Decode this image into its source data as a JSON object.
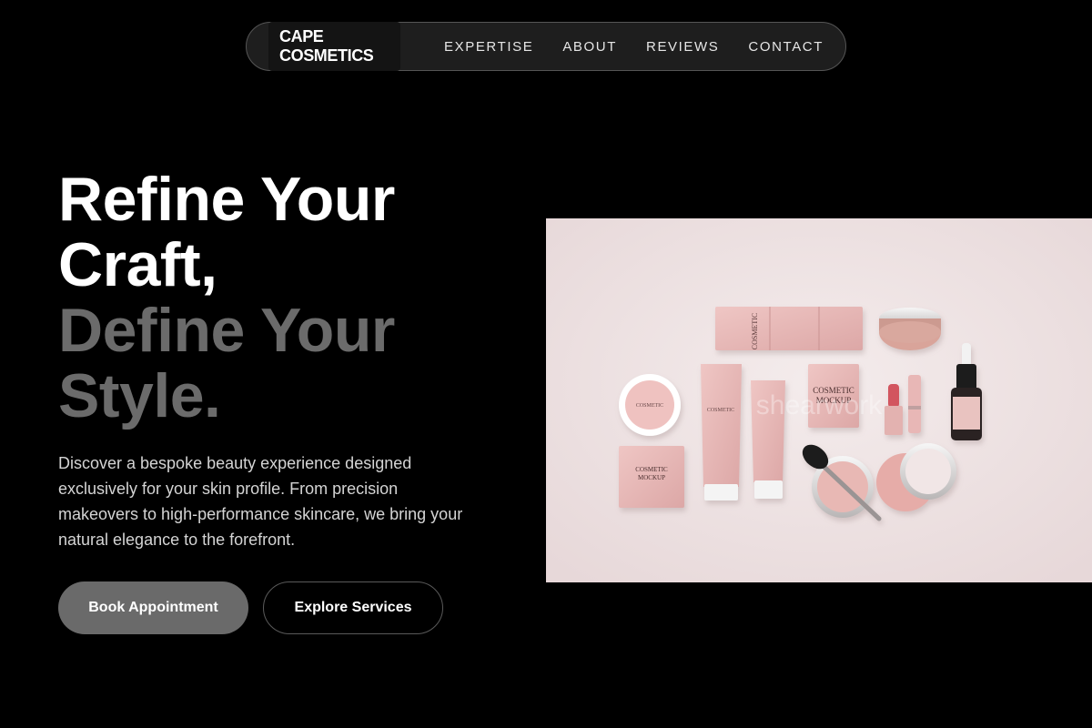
{
  "nav": {
    "brand": "CAPE COSMETICS",
    "links": [
      "EXPERTISE",
      "ABOUT",
      "REVIEWS",
      "CONTACT"
    ]
  },
  "hero": {
    "headline_white": [
      "Refine Your",
      "Craft,"
    ],
    "headline_grey": [
      "Define Your",
      "Style."
    ],
    "description": "Discover a bespoke beauty experience designed exclusively for your skin profile. From precision makeovers to high-performance skincare, we bring your natural elegance to the forefront.",
    "primary_button": "Book Appointment",
    "secondary_button": "Explore Services"
  },
  "image": {
    "watermark": "shearwork",
    "box_label": "COSMETIC MOCKUP",
    "sachet_label": "COSMETIC MOCKUP",
    "compact_label": "COSMETIC MOCKUP"
  },
  "colors": {
    "background": "#000000",
    "nav_bg": "#1e1e1e",
    "accent_grey": "#6b6b6b",
    "primary_button": "#6a6a6a",
    "product_pink": "#e9b8b8",
    "image_bg": "#ecdfe0"
  }
}
